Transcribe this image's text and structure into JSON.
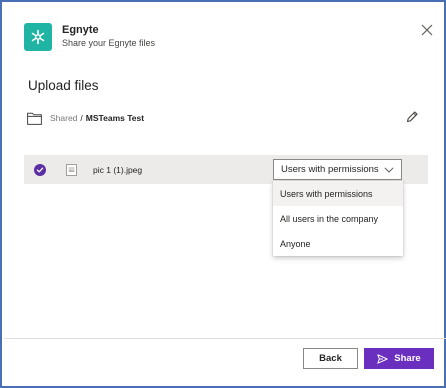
{
  "app": {
    "title": "Egnyte",
    "subtitle": "Share your Egnyte files"
  },
  "section_title": "Upload files",
  "path": {
    "parent": "Shared",
    "separator": "/",
    "current": "MSTeams Test"
  },
  "files": [
    {
      "name": "pic 1 (1).jpeg",
      "selected": true
    }
  ],
  "permission": {
    "value": "Users with permissions",
    "options": [
      "Users with permissions",
      "All users in the company",
      "Anyone"
    ]
  },
  "footer": {
    "back_label": "Back",
    "share_label": "Share"
  },
  "colors": {
    "brand": "#1fb4a4",
    "accent": "#6b2fbf",
    "frame": "#4a6fb5"
  },
  "icons": [
    "egnyte-logo-icon",
    "close-icon",
    "folder-icon",
    "pencil-icon",
    "checkmark-icon",
    "image-file-icon",
    "chevron-down-icon",
    "send-icon"
  ]
}
